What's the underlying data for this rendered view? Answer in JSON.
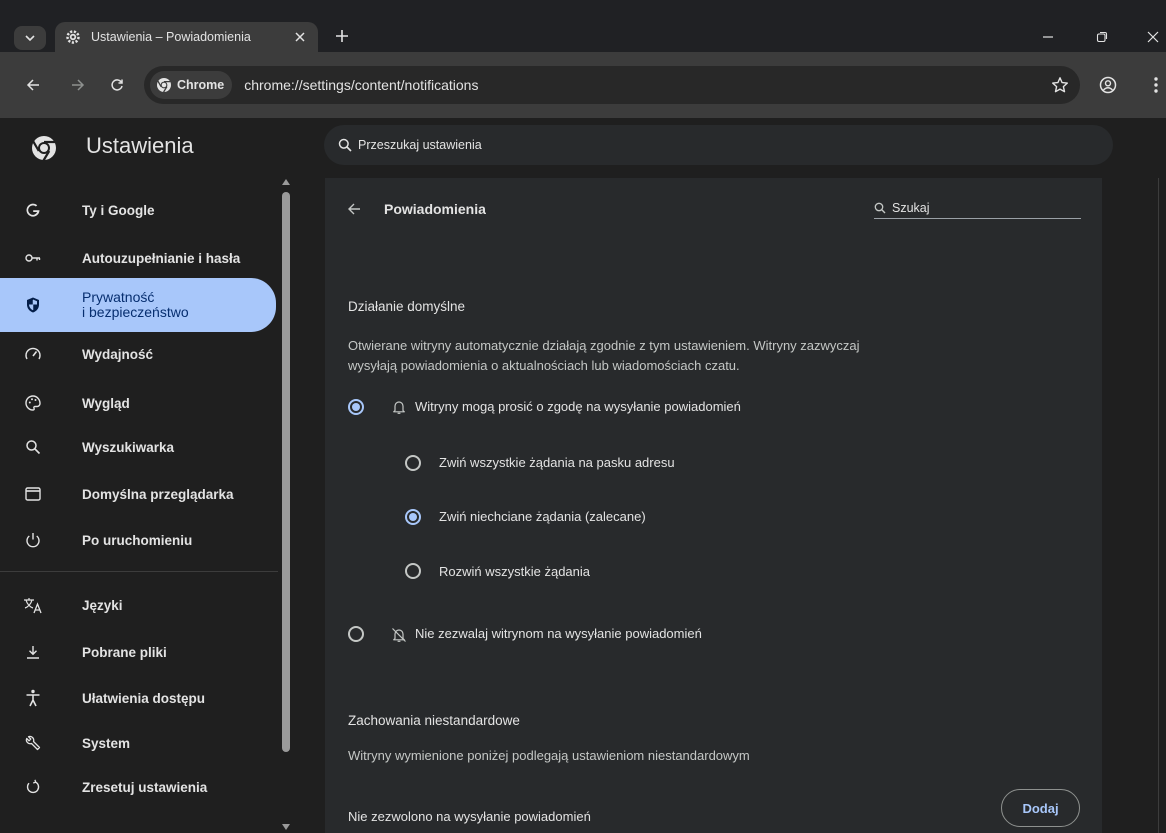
{
  "browser": {
    "tab_title": "Ustawienia – Powiadomienia",
    "chip_label": "Chrome",
    "url": "chrome://settings/content/notifications"
  },
  "header": {
    "title": "Ustawienia",
    "search_placeholder": "Przeszukaj ustawienia"
  },
  "sidebar": {
    "items": [
      {
        "label": "Ty i Google",
        "icon": "google-icon"
      },
      {
        "label": "Autouzupełnianie i hasła",
        "icon": "key-icon"
      },
      {
        "label": "Prywatność\ni bezpieczeństwo",
        "icon": "shield-icon",
        "active": true
      },
      {
        "label": "Wydajność",
        "icon": "gauge-icon"
      },
      {
        "label": "Wygląd",
        "icon": "palette-icon"
      },
      {
        "label": "Wyszukiwarka",
        "icon": "search-icon"
      },
      {
        "label": "Domyślna przeglądarka",
        "icon": "browser-icon"
      },
      {
        "label": "Po uruchomieniu",
        "icon": "power-icon"
      },
      {
        "label": "Języki",
        "icon": "translate-icon"
      },
      {
        "label": "Pobrane pliki",
        "icon": "download-icon"
      },
      {
        "label": "Ułatwienia dostępu",
        "icon": "accessibility-icon"
      },
      {
        "label": "System",
        "icon": "wrench-icon"
      },
      {
        "label": "Zresetuj ustawienia",
        "icon": "reset-icon"
      }
    ]
  },
  "page": {
    "title": "Powiadomienia",
    "search_placeholder": "Szukaj",
    "default_section": {
      "title": "Działanie domyślne",
      "description": "Otwierane witryny automatycznie działają zgodnie z tym ustawieniem. Witryny zazwyczaj wysyłają powiadomienia o aktualnościach lub wiadomościach czatu.",
      "allow_option": "Witryny mogą prosić o zgodę na wysyłanie powiadomień",
      "sub_options": [
        "Zwiń wszystkie żądania na pasku adresu",
        "Zwiń niechciane żądania (zalecane)",
        "Rozwiń wszystkie żądania"
      ],
      "block_option": "Nie zezwalaj witrynom na wysyłanie powiadomień"
    },
    "custom_section": {
      "title": "Zachowania niestandardowe",
      "description": "Witryny wymienione poniżej podlegają ustawieniom niestandardowym",
      "blocked_label": "Nie zezwolono na wysyłanie powiadomień",
      "add_button": "Dodaj"
    }
  }
}
